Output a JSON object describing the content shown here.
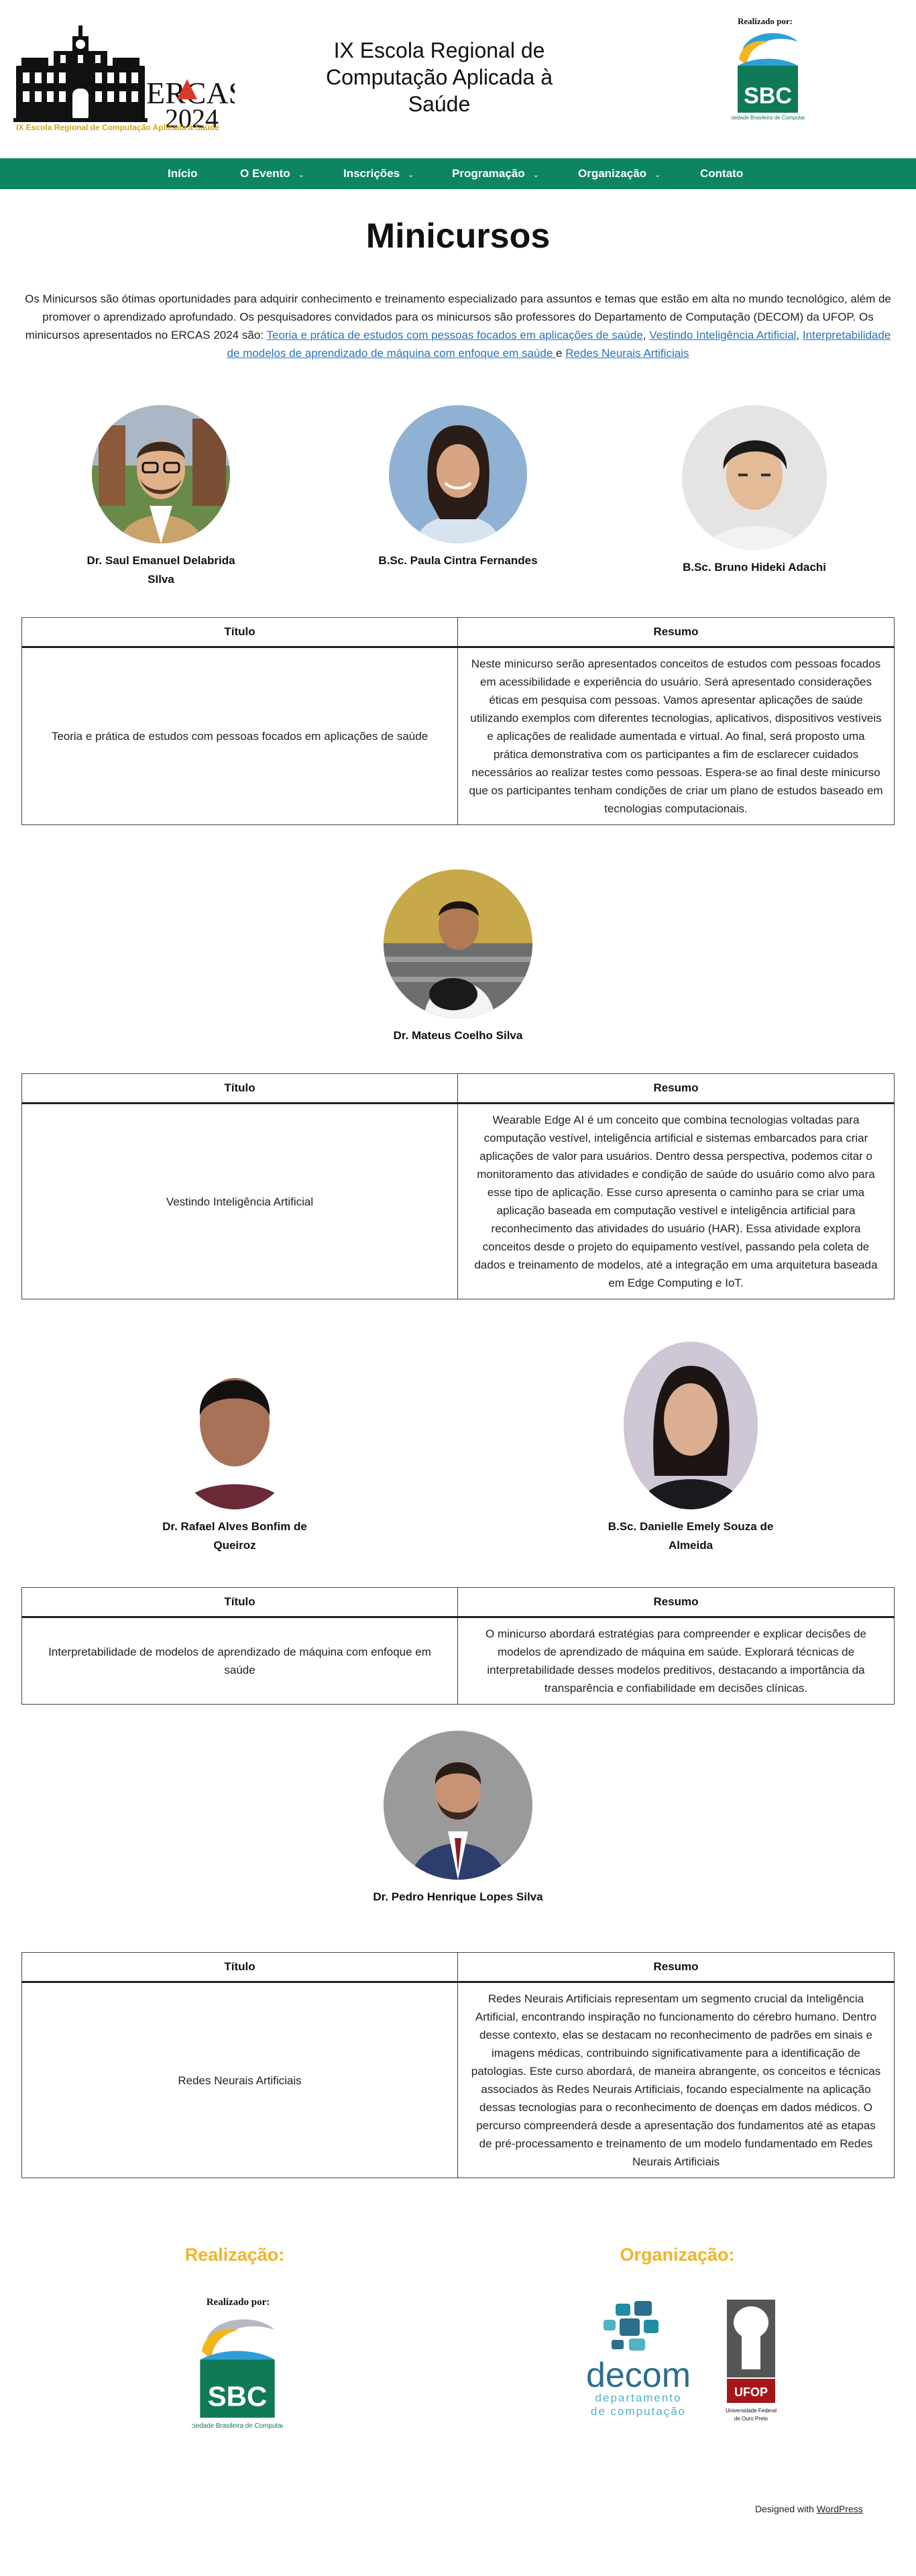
{
  "header": {
    "logo_text": "ERCAS",
    "logo_year": "2024",
    "logo_tagline": "IX Escola Regional de Computação Aplicada à Saúde",
    "site_title": "IX Escola Regional de Computação Aplicada à Saúde",
    "realizado_label": "Realizado por:",
    "sbc_logo_text": "SBC",
    "sbc_caption": "Sociedade Brasileira de Computação"
  },
  "nav": {
    "items": [
      {
        "label": "Início",
        "has_dropdown": false
      },
      {
        "label": "O Evento",
        "has_dropdown": true
      },
      {
        "label": "Inscrições",
        "has_dropdown": true
      },
      {
        "label": "Programação",
        "has_dropdown": true
      },
      {
        "label": "Organização",
        "has_dropdown": true
      },
      {
        "label": "Contato",
        "has_dropdown": false
      }
    ],
    "caret": "⌄"
  },
  "page": {
    "title": "Minicursos",
    "intro_text": "Os Minicursos são ótimas oportunidades para adquirir conhecimento e treinamento especializado para assuntos e temas que estão em alta no mundo tecnológico, além de promover o aprendizado aprofundado. Os pesquisadores convidados para os minicursos são professores do Departamento de Computação (DECOM) da UFOP. Os minicursos apresentados no ERCAS 2024 são: ",
    "intro_links": [
      "Teoria e prática de estudos com pessoas focados em aplicações de saúde",
      "Vestindo Inteligência Artificial",
      "Interpretabilidade de modelos de aprendizado de máquina com enfoque em saúde ",
      "Redes Neurais Artificiais"
    ],
    "sep_comma": ", ",
    "sep_and": " e "
  },
  "courses": [
    {
      "speakers": [
        "Dr. Saul Emanuel Delabrida SIlva",
        "B.Sc. Paula Cintra Fernandes",
        "B.Sc. Bruno Hideki Adachi"
      ],
      "table": {
        "header_title": "Título",
        "header_summary": "Resumo",
        "title": "Teoria e prática de estudos com pessoas focados em aplicações de saúde",
        "summary": "Neste minicurso serão apresentados conceitos de estudos com pessoas focados em acessibilidade e experiência do usuário. Será apresentado considerações éticas em pesquisa com pessoas. Vamos apresentar aplicações de saúde utilizando exemplos com diferentes tecnologias, aplicativos, dispositivos vestíveis e aplicações de realidade aumentada e virtual. Ao final, será proposto uma prática demonstrativa com os participantes a fim de esclarecer cuidados necessários ao realizar testes como pessoas. Espera-se ao final deste minicurso que os participantes tenham condições de criar um plano de estudos baseado em tecnologias computacionais."
      }
    },
    {
      "speakers": [
        "Dr. Mateus Coelho Silva"
      ],
      "table": {
        "header_title": "Título",
        "header_summary": "Resumo",
        "title": "Vestindo Inteligência Artificial",
        "summary": "Wearable Edge AI é um conceito que combina tecnologias voltadas para computação vestível, inteligência artificial e sistemas embarcados para criar aplicações de valor para usuários. Dentro dessa perspectiva, podemos citar o monitoramento das atividades e condição de saúde do usuário como alvo para esse tipo de aplicação. Esse curso apresenta o caminho para se criar uma aplicação baseada em computação vestível e inteligência artificial para reconhecimento das atividades do usuário (HAR). Essa atividade explora conceitos desde o projeto do equipamento vestível, passando pela coleta de dados e treinamento de modelos, até a integração em uma arquitetura baseada em Edge Computing e IoT."
      }
    },
    {
      "speakers": [
        "Dr. Rafael Alves Bonfim de Queiroz",
        "B.Sc. Danielle Emely Souza de Almeida"
      ],
      "table": {
        "header_title": "Título",
        "header_summary": "Resumo",
        "title": "Interpretabilidade de modelos de aprendizado de máquina com enfoque em saúde",
        "summary": "O minicurso abordará estratégias para compreender e explicar decisões de modelos de aprendizado de máquina em saúde. Explorará técnicas de interpretabilidade desses modelos preditivos, destacando a importância da transparência e confiabilidade em decisões clínicas."
      }
    },
    {
      "speakers": [
        "Dr. Pedro Henrique Lopes Silva"
      ],
      "table": {
        "header_title": "Título",
        "header_summary": "Resumo",
        "title": "Redes Neurais Artificiais",
        "summary": "Redes Neurais Artificiais representam um segmento crucial da Inteligência Artificial, encontrando inspiração no funcionamento do cérebro humano. Dentro desse contexto, elas se destacam no reconhecimento de padrões em sinais e imagens médicas, contribuindo significativamente para a identificação de patologias. Este curso abordará, de maneira abrangente, os conceitos e técnicas associados às Redes Neurais Artificiais, focando especialmente na aplicação dessas tecnologias para o reconhecimento de doenças em dados médicos. O percurso compreenderá desde a apresentação dos fundamentos até as etapas de pré-processamento e treinamento de um modelo fundamentado em Redes Neurais Artificiais"
      }
    }
  ],
  "footer": {
    "realizacao_heading": "Realização:",
    "organizacao_heading": "Organização:",
    "realizado_label": "Realizado por:",
    "sbc_logo_text": "SBC",
    "sbc_caption": "Sociedade Brasileira de Computação",
    "decom_name": "decom",
    "decom_sub1": "departamento",
    "decom_sub2": "de computação",
    "ufop_name": "UFOP",
    "ufop_caption": "Universidade Federal de Ouro Preto",
    "designed_prefix": "Designed with ",
    "designed_link": "WordPress"
  },
  "colors": {
    "nav_bg": "#0d8563",
    "link": "#2a72b8",
    "footer_heading": "#f0b427",
    "logo_accent": "#d63a2a",
    "sbc_green": "#0f7a55",
    "decom_blue": "#2b6e8e",
    "ufop_red": "#a4161a"
  }
}
